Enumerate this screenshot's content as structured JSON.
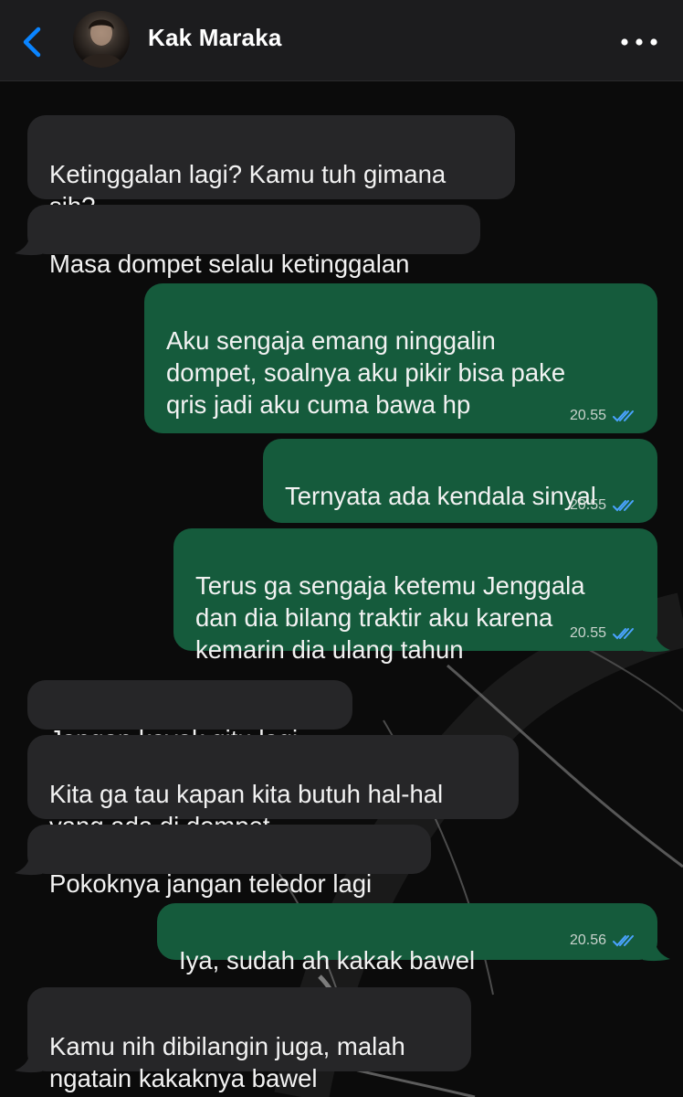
{
  "header": {
    "contact_name": "Kak Maraka",
    "back_icon": "chevron-left-icon",
    "more_icon": "more-dots-icon"
  },
  "colors": {
    "incoming_bubble": "#262628",
    "outgoing_bubble": "#155b3c",
    "read_check": "#4aa3ff",
    "back_accent": "#0a84ff"
  },
  "messages": [
    {
      "direction": "in",
      "text": "Ketinggalan lagi? Kamu tuh gimana\nsih?"
    },
    {
      "direction": "in",
      "text": "Masa dompet selalu ketinggalan"
    },
    {
      "direction": "out",
      "text": "Aku sengaja emang ninggalin\ndompet, soalnya aku pikir bisa pake\nqris jadi aku cuma bawa hp",
      "time": "20.55",
      "status": "read"
    },
    {
      "direction": "out",
      "text": "Ternyata ada kendala sinyal",
      "time": "20.55",
      "status": "read"
    },
    {
      "direction": "out",
      "text": "Terus ga sengaja ketemu Jenggala\ndan dia bilang traktir aku karena\nkemarin dia ulang tahun",
      "time": "20.55",
      "status": "read"
    },
    {
      "direction": "in",
      "text": "Jangan kayak gitu lagi"
    },
    {
      "direction": "in",
      "text": "Kita ga tau kapan kita butuh hal-hal\nyang ada di dompet"
    },
    {
      "direction": "in",
      "text": "Pokoknya jangan teledor lagi"
    },
    {
      "direction": "out",
      "text": "Iya, sudah ah kakak bawel",
      "time": "20.56",
      "status": "read"
    },
    {
      "direction": "in",
      "text": "Kamu nih dibilangin juga, malah\nngatain kakaknya bawel"
    }
  ]
}
